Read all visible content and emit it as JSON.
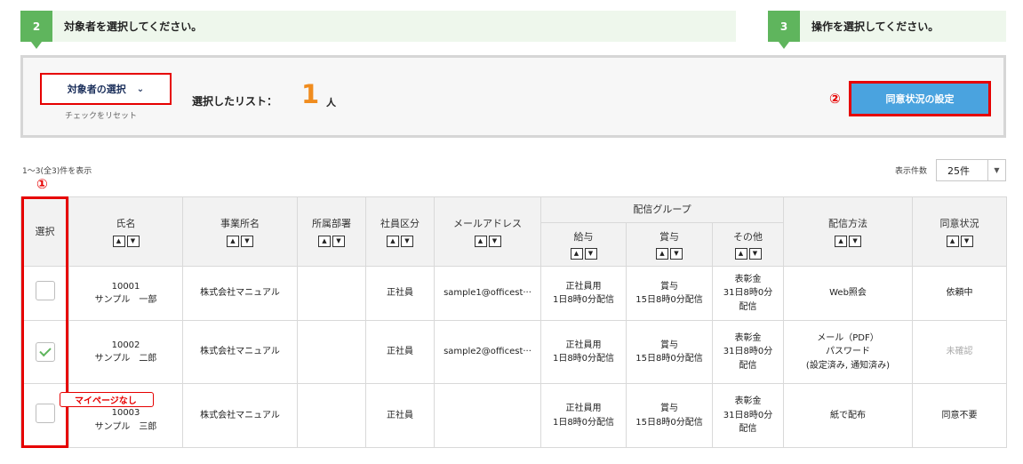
{
  "steps": [
    {
      "num": "2",
      "title": "対象者を選択してください。"
    },
    {
      "num": "3",
      "title": "操作を選択してください。"
    }
  ],
  "panel": {
    "select_button": "対象者の選択",
    "reset_link": "チェックをリセット",
    "list_label": "選択したリスト：",
    "list_count": "1",
    "list_unit": "人",
    "agree_button": "同意状況の設定",
    "marker2": "②"
  },
  "paging": {
    "range": "1〜3(全3)件を表示",
    "per_label": "表示件数",
    "per_value": "25件"
  },
  "marker1": "①",
  "no_mypage_label": "マイページなし",
  "columns": {
    "select": "選択",
    "name": "氏名",
    "office": "事業所名",
    "dept": "所属部署",
    "emp_type": "社員区分",
    "email": "メールアドレス",
    "group": "配信グループ",
    "salary": "給与",
    "bonus": "賞与",
    "other": "その他",
    "method": "配信方法",
    "consent": "同意状況"
  },
  "rows": [
    {
      "checked": false,
      "id": "10001",
      "name": "サンプル　一部",
      "office": "株式会社マニュアル",
      "dept": "",
      "emp_type": "正社員",
      "email": "sample1@officest···",
      "salary": [
        "正社員用",
        "1日8時0分配信"
      ],
      "bonus": [
        "賞与",
        "15日8時0分配信"
      ],
      "other": [
        "表彰金",
        "31日8時0分",
        "配信"
      ],
      "method": [
        "Web照会"
      ],
      "consent": "依頼中",
      "consent_muted": false
    },
    {
      "checked": true,
      "id": "10002",
      "name": "サンプル　二郎",
      "office": "株式会社マニュアル",
      "dept": "",
      "emp_type": "正社員",
      "email": "sample2@officest···",
      "salary": [
        "正社員用",
        "1日8時0分配信"
      ],
      "bonus": [
        "賞与",
        "15日8時0分配信"
      ],
      "other": [
        "表彰金",
        "31日8時0分",
        "配信"
      ],
      "method": [
        "メール（PDF）",
        "パスワード",
        "(設定済み, 通知済み)"
      ],
      "consent": "未確認",
      "consent_muted": true
    },
    {
      "checked": false,
      "id": "10003",
      "name": "サンプル　三郎",
      "office": "株式会社マニュアル",
      "dept": "",
      "emp_type": "正社員",
      "email": "",
      "salary": [
        "正社員用",
        "1日8時0分配信"
      ],
      "bonus": [
        "賞与",
        "15日8時0分配信"
      ],
      "other": [
        "表彰金",
        "31日8時0分",
        "配信"
      ],
      "method": [
        "紙で配布"
      ],
      "consent": "同意不要",
      "consent_muted": false
    }
  ]
}
